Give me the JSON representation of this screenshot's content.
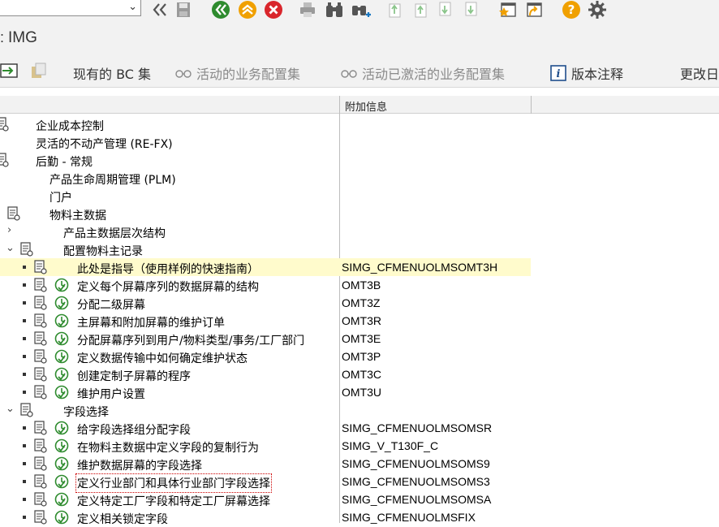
{
  "title": "IMG",
  "toolbar2": {
    "current_bc": "现有的 BC 集",
    "active_bc": "活动的业务配置集",
    "activated_bc": "活动已激活的业务配置集",
    "release_notes": "版本注释",
    "changes": "更改日"
  },
  "column_header": "附加信息",
  "tree": [
    {
      "label": "企业成本控制",
      "info": ""
    },
    {
      "label": "灵活的不动产管理 (RE-FX)",
      "info": ""
    },
    {
      "label": "后勤 - 常规",
      "info": ""
    },
    {
      "label": "产品生命周期管理 (PLM)",
      "info": ""
    },
    {
      "label": "门户",
      "info": ""
    },
    {
      "label": "物料主数据",
      "info": ""
    },
    {
      "label": "产品主数据层次结构",
      "info": ""
    },
    {
      "label": "配置物料主记录",
      "info": ""
    },
    {
      "label": "此处是指导（使用样例的快速指南）",
      "info": "SIMG_CFMENUOLMSOMT3H"
    },
    {
      "label": "定义每个屏幕序列的数据屏幕的结构",
      "info": "OMT3B"
    },
    {
      "label": "分配二级屏幕",
      "info": "OMT3Z"
    },
    {
      "label": "主屏幕和附加屏幕的维护订单",
      "info": "OMT3R"
    },
    {
      "label": "分配屏幕序列到用户/物料类型/事务/工厂部门",
      "info": "OMT3E"
    },
    {
      "label": "定义数据传输中如何确定维护状态",
      "info": "OMT3P"
    },
    {
      "label": "创建定制子屏幕的程序",
      "info": "OMT3C"
    },
    {
      "label": "维护用户设置",
      "info": "OMT3U"
    },
    {
      "label": "字段选择",
      "info": ""
    },
    {
      "label": "给字段选择组分配字段",
      "info": "SIMG_CFMENUOLMSOMSR"
    },
    {
      "label": "在物料主数据中定义字段的复制行为",
      "info": "SIMG_V_T130F_C"
    },
    {
      "label": "维护数据屏幕的字段选择",
      "info": "SIMG_CFMENUOLMSOMS9"
    },
    {
      "label": "定义行业部门和具体行业部门字段选择",
      "info": "SIMG_CFMENUOLMSOMS3"
    },
    {
      "label": "定义特定工厂字段和特定工厂屏幕选择",
      "info": "SIMG_CFMENUOLMSOMSA"
    },
    {
      "label": "定义相关锁定字段",
      "info": "SIMG_CFMENUOLMSFIX"
    }
  ],
  "colors": {
    "accent_green": "#2e8b2e",
    "highlight": "#fffbcc",
    "stop_red": "#d9262c",
    "help_orange": "#f0a000"
  }
}
